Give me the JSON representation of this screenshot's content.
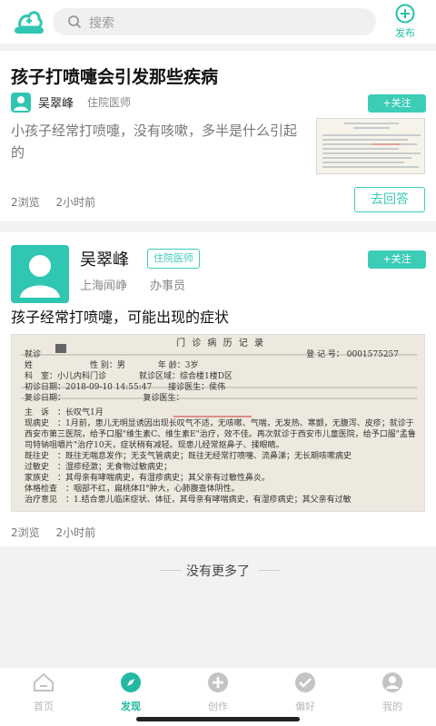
{
  "header": {
    "search_placeholder": "搜索",
    "publish_label": "发布"
  },
  "posts": [
    {
      "title": "孩子打喷嚏会引发那些疾病",
      "author": "吴翠峰",
      "role": "住院医师",
      "follow_label": "+关注",
      "excerpt": "小孩子经常打喷嚏，没有咳嗽，多半是什么引起的",
      "views": "2浏览",
      "time": "2小时前",
      "answer_label": "去回答"
    },
    {
      "author": "吴翠峰",
      "badge": "住院医师",
      "follow_label": "+关注",
      "location": "上海闻峥",
      "job": "办事员",
      "title": "孩子经常打喷嚏，可能出现的症状",
      "views": "2浏览",
      "time": "2小时前",
      "record": {
        "heading": "门 诊 病 历 记 录",
        "row1": "就诊",
        "reg_no": "登 记 号： 0001575257",
        "row2": "姓　　　　　　　性 别：男　　　　年 龄：3岁",
        "row3": "科　室：小儿内科门诊　　　　就诊区域：综合楼1楼D区",
        "row4": "初诊日期：2018-09-10 14:55:47　　接诊医生：侯伟",
        "row5": "复诊日期：　　　　　　　　　　复诊医生：",
        "complaint": "主　诉　：长叹气1月",
        "history": "现病史　：1月前，患儿无明显诱因出现长叹气不适，无咳嗽、气喘，无发热、寒颤，无腹泻、皮疹；就诊于西安市第三医院，给予口服\"维生素C、维生素E\"治疗，效不佳。再次就诊于西安市儿童医院，给予口服\"孟鲁司特钠咀嚼片\"治疗10天，症状稍有减轻。现患儿经常抠鼻子、揉眼睛。",
        "past": "既往史　：既往无喘息发作；无支气管病史；既往无经常打喷嚏、流鼻涕；无长期咳嗽病史",
        "allergy": "过敏史　：湿疹经激；无食物过敏病史；",
        "family": "家族史　：其母亲有哮喘病史，有湿疹病史；其父亲有过敏性鼻炎。",
        "exam": "体格检查　：咽部不红，扁桃体II°肿大，心肺腹查体阴性。",
        "plan": "治疗意见　：1.结合患儿临床症状、体征，其母亲有哮喘病史，有湿疹病史；其父亲有过敏"
      }
    }
  ],
  "no_more": "没有更多了",
  "nav": [
    {
      "label": "首页",
      "icon": "home-icon"
    },
    {
      "label": "发现",
      "icon": "compass-icon"
    },
    {
      "label": "创作",
      "icon": "plus-circle-icon"
    },
    {
      "label": "偏好",
      "icon": "check-icon"
    },
    {
      "label": "我的",
      "icon": "user-icon"
    }
  ],
  "colors": {
    "accent": "#3ccdb6",
    "accent_dark": "#23b8a0"
  }
}
